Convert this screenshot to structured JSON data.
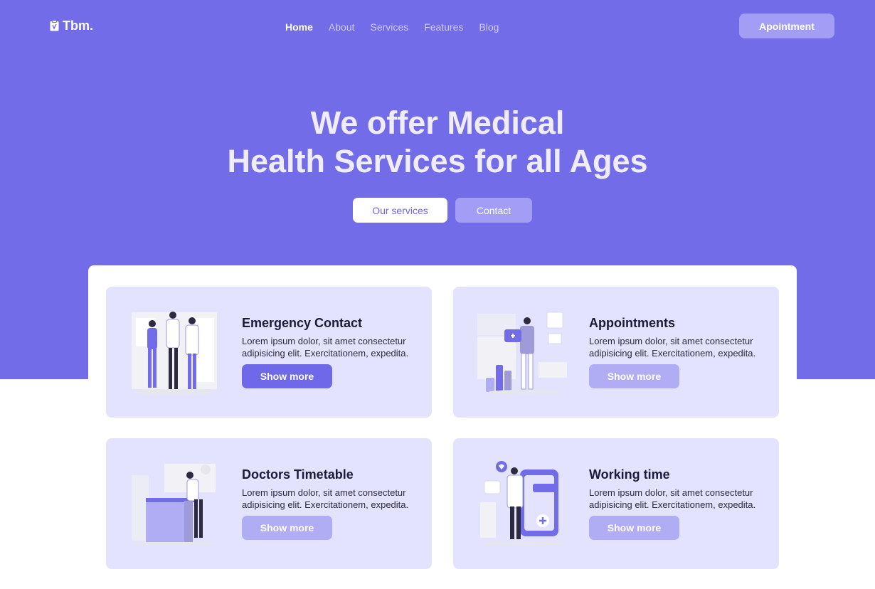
{
  "brand": {
    "name": "Tbm."
  },
  "nav": {
    "items": [
      "Home",
      "About",
      "Services",
      "Features",
      "Blog"
    ]
  },
  "header": {
    "cta_label": "Apointment"
  },
  "hero": {
    "title_line1": "We offer Medical",
    "title_line2": "Health Services for all Ages",
    "primary_label": "Our services",
    "secondary_label": "Contact"
  },
  "cards": [
    {
      "title": "Emergency Contact",
      "text": "Lorem ipsum dolor, sit amet consectetur adipisicing elit. Exercitationem, expedita.",
      "button": "Show more",
      "icon": "medical-team-illustration"
    },
    {
      "title": "Appointments",
      "text": "Lorem ipsum dolor, sit amet consectetur adipisicing elit. Exercitationem, expedita.",
      "button": "Show more",
      "icon": "doctor-clipboard-illustration"
    },
    {
      "title": "Doctors Timetable",
      "text": "Lorem ipsum dolor, sit amet consectetur adipisicing elit. Exercitationem, expedita.",
      "button": "Show more",
      "icon": "doctor-desk-illustration"
    },
    {
      "title": "Working time",
      "text": "Lorem ipsum dolor, sit amet consectetur adipisicing elit. Exercitationem, expedita.",
      "button": "Show more",
      "icon": "doctor-phone-illustration"
    }
  ],
  "colors": {
    "primary": "#736ce9",
    "card_bg": "#e3e3ff",
    "button_muted": "#b0adf4"
  }
}
